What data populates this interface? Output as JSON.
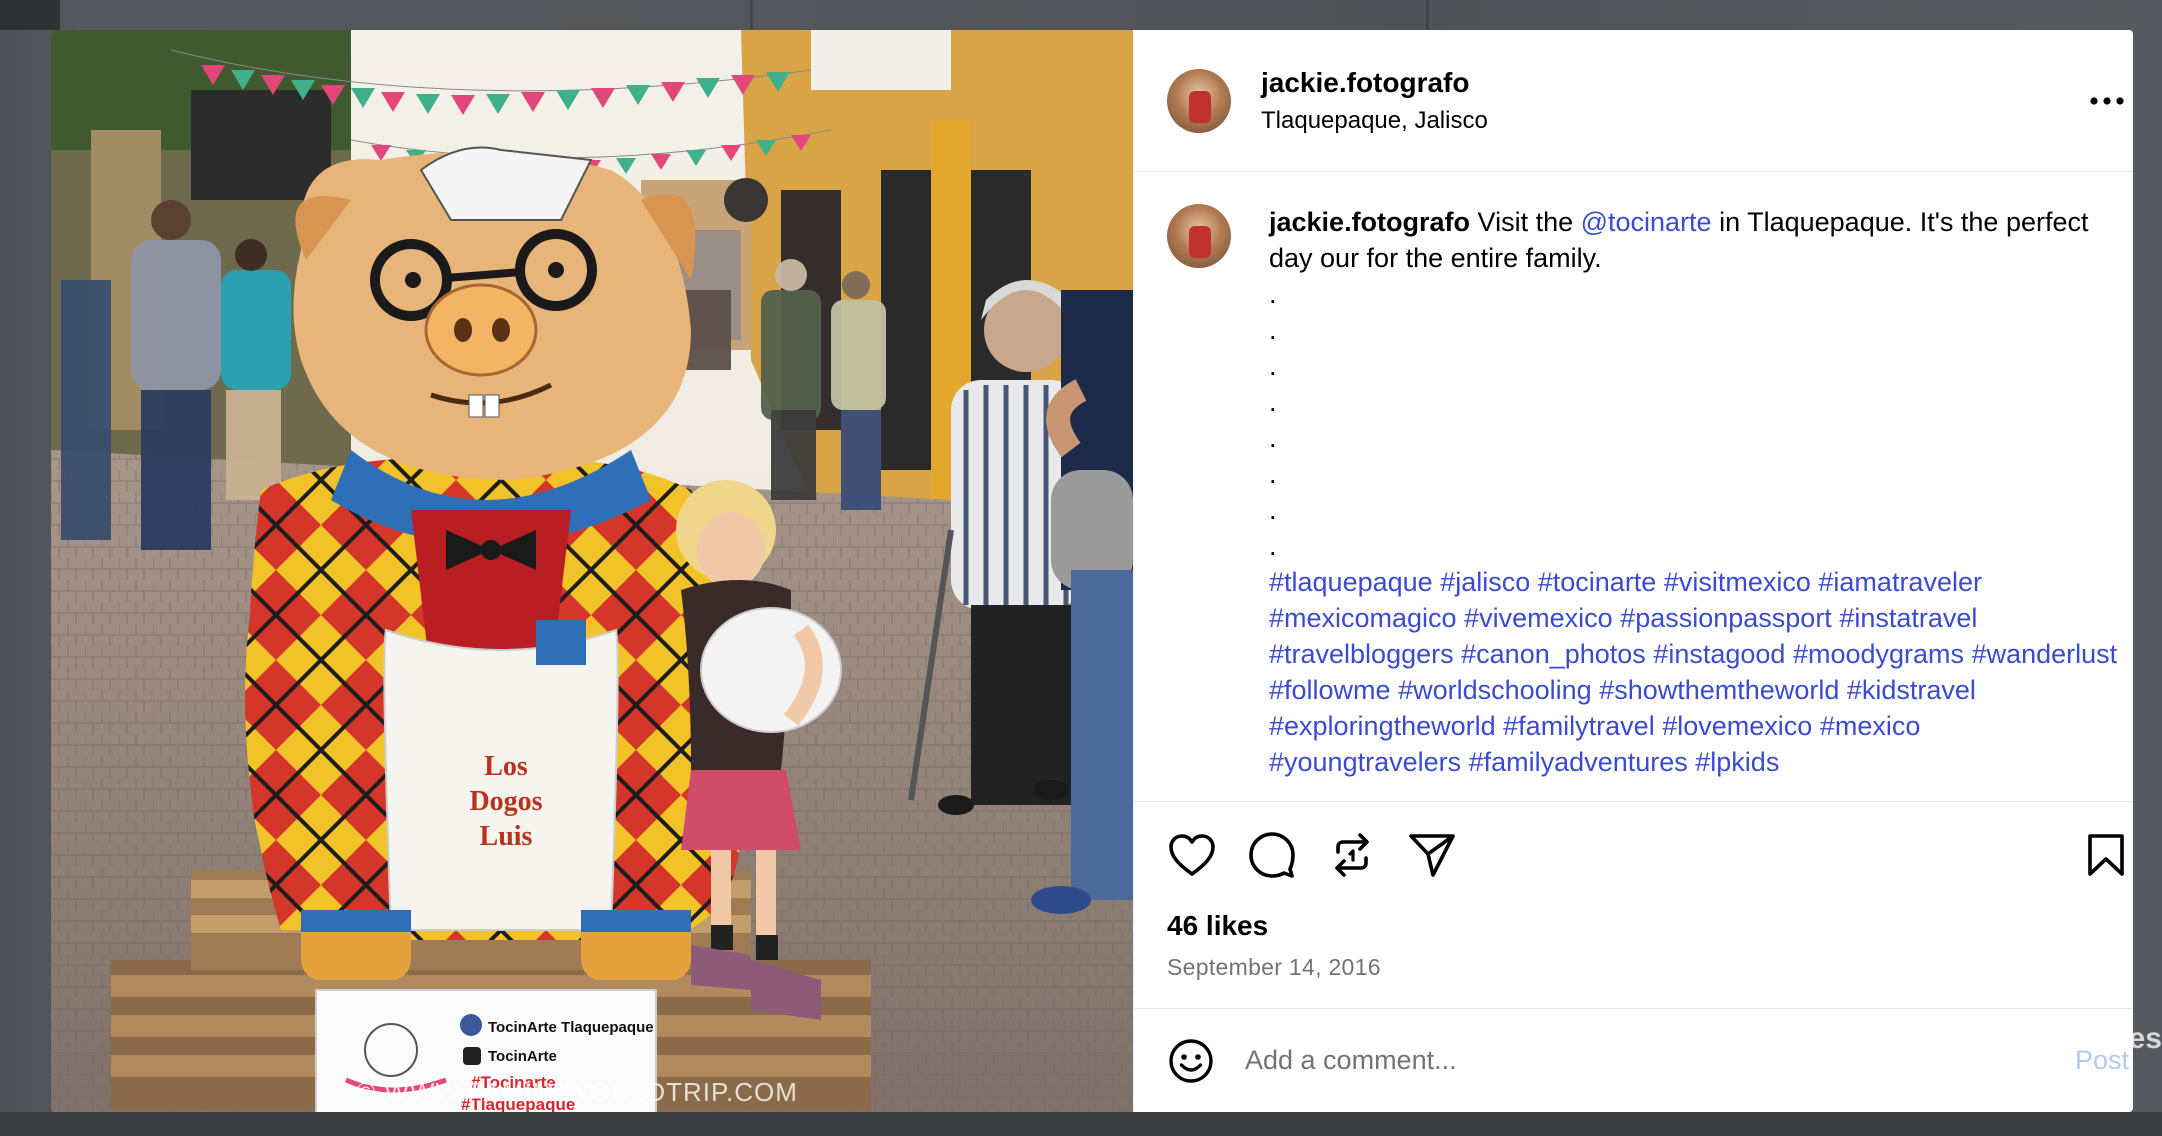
{
  "backdrop": {
    "peek_text": "es"
  },
  "post": {
    "username": "jackie.fotografo",
    "location": "Tlaquepaque, Jalisco",
    "caption": {
      "username": "jackie.fotografo",
      "text_before": " Visit the ",
      "mention": "@tocinarte",
      "text_after": " in Tlaquepaque. It's the perfect day our for the entire family.",
      "dots": [
        ".",
        ".",
        ".",
        ".",
        ".",
        ".",
        ".",
        "."
      ],
      "hashtags": [
        "#tlaquepaque",
        "#jalisco",
        "#tocinarte",
        "#visitmexico",
        "#iamatraveler",
        "#mexicomagico",
        "#vivemexico",
        "#passionpassport",
        "#instatravel",
        "#travelbloggers",
        "#canon_photos",
        "#instagood",
        "#moodygrams",
        "#wanderlust",
        "#followme",
        "#worldschooling",
        "#showthemtheworld",
        "#kidstravel",
        "#exploringtheworld",
        "#familytravel",
        "#lovemexico",
        "#mexico",
        "#youngtravelers",
        "#familyadventures",
        "#lpkids"
      ]
    },
    "likes": "46 likes",
    "date": "September 14, 2016",
    "photo": {
      "watermark": "© WWW.FAMILYWORLDTRIP.COM",
      "sign_line1": "TocinArte Tlaquepaque",
      "sign_line2": "TocinArte",
      "sign_line3": "#Tocinarte",
      "sign_line4": "#Tlaquepaque",
      "apron_line1": "Los",
      "apron_line2": "Dogos",
      "apron_line3": "Luis"
    }
  },
  "actions": {
    "like_icon": "heart-icon",
    "comment_icon": "comment-icon",
    "repost_icon": "repost-icon",
    "share_icon": "send-icon",
    "save_icon": "bookmark-icon"
  },
  "comment_bar": {
    "placeholder": "Add a comment...",
    "post_label": "Post",
    "emoji_icon": "emoji-icon"
  },
  "colors": {
    "link": "#3b4bd0",
    "post_disabled": "#b2c9f7",
    "muted": "#737373"
  }
}
